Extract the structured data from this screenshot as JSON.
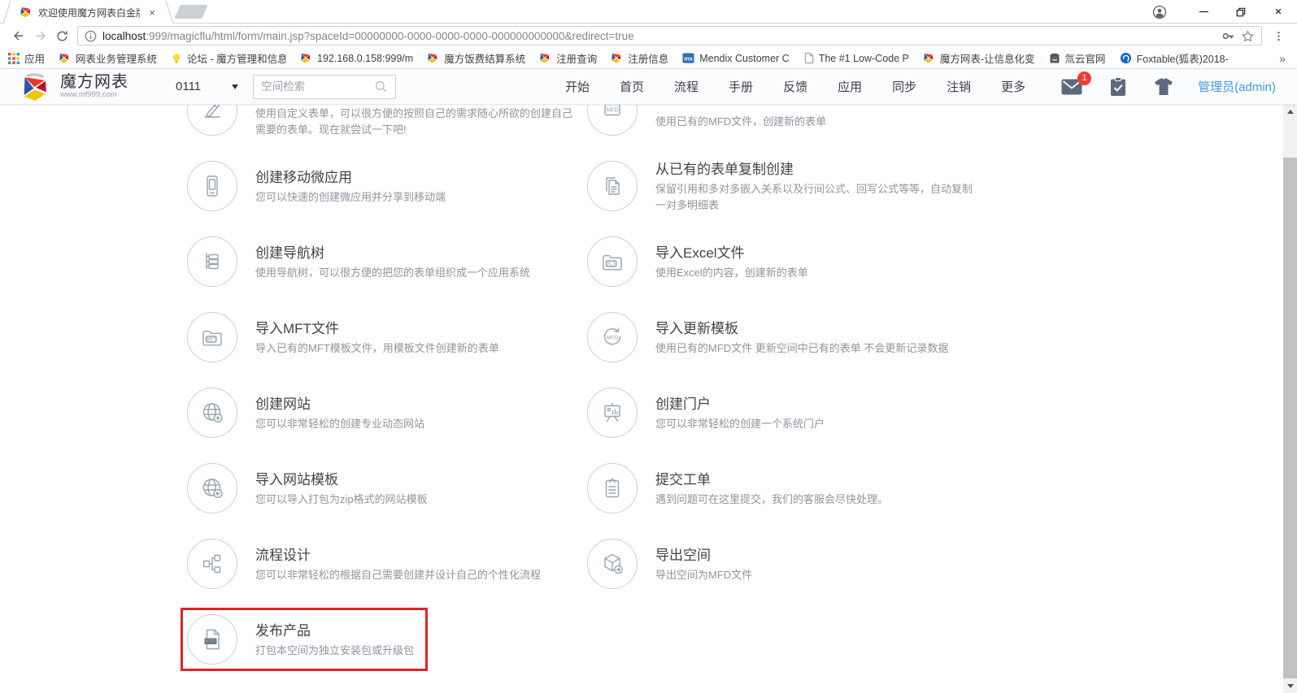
{
  "browser": {
    "tab_title": "欢迎使用魔方网表白金版",
    "tab_close": "×",
    "url_host": "localhost",
    "url_rest": ":999/magicflu/html/form/main.jsp?spaceId=00000000-0000-0000-0000-000000000000&redirect=true",
    "bookmarks": [
      {
        "icon": "apps-grid-icon",
        "label": "应用"
      },
      {
        "icon": "magicflu-favicon",
        "label": "网表业务管理系统"
      },
      {
        "icon": "lamp-icon",
        "label": "论坛 - 魔方管理和信息"
      },
      {
        "icon": "magicflu-favicon",
        "label": "192.168.0.158:999/m"
      },
      {
        "icon": "magicflu-favicon",
        "label": "魔方饭费结算系统"
      },
      {
        "icon": "magicflu-favicon",
        "label": "注册查询"
      },
      {
        "icon": "magicflu-favicon",
        "label": "注册信息"
      },
      {
        "icon": "mendix-icon",
        "label": "Mendix Customer C"
      },
      {
        "icon": "page-icon",
        "label": "The #1 Low-Code P"
      },
      {
        "icon": "magicflu-favicon",
        "label": "魔方网表-让信息化变"
      },
      {
        "icon": "hcloud-icon",
        "label": "氚云官网"
      },
      {
        "icon": "foxtable-icon",
        "label": "Foxtable(狐表)2018-"
      }
    ],
    "bookmarks_overflow": "»"
  },
  "header": {
    "logo_title": "魔方网表",
    "logo_sub": "www.mf999.com",
    "space_id": "0111",
    "search_placeholder": "空间检索",
    "nav": [
      "开始",
      "首页",
      "流程",
      "手册",
      "反馈",
      "应用",
      "同步",
      "注销",
      "更多"
    ],
    "badge_count": "1",
    "user": "管理员(admin)",
    "accent_blue": "#3d9be0",
    "badge_red": "#f23c30"
  },
  "features": {
    "highlight_color": "#e82020",
    "rows": [
      {
        "left": {
          "title": "",
          "desc": "使用自定义表单，可以很方便的按照自己的需求随心所欲的创建自己需要的表单。现在就尝试一下吧!",
          "icon": "form-pen-icon"
        },
        "right": {
          "title": "",
          "desc": "使用已有的MFD文件，创建新的表单",
          "icon": "mfd-file-icon"
        }
      },
      {
        "left": {
          "title": "创建移动微应用",
          "desc": "您可以快速的创建微应用并分享到移动端",
          "icon": "smartphone-icon"
        },
        "right": {
          "title": "从已有的表单复制创建",
          "desc": "保留引用和多对多嵌入关系以及行间公式、回写公式等等，自动复制一对多明细表",
          "icon": "copy-docs-icon"
        }
      },
      {
        "left": {
          "title": "创建导航树",
          "desc": "使用导航树，可以很方便的把您的表单组织成一个应用系统",
          "icon": "nav-tree-icon"
        },
        "right": {
          "title": "导入Excel文件",
          "desc": "使用Excel的内容，创建新的表单",
          "icon": "xls-folder-icon"
        }
      },
      {
        "left": {
          "title": "导入MFT文件",
          "desc": "导入已有的MFT模板文件，用模板文件创建新的表单",
          "icon": "mft-folder-icon"
        },
        "right": {
          "title": "导入更新模板",
          "desc": "使用已有的MFD文件 更新空间中已有的表单 不会更新记录数据",
          "icon": "mfd-refresh-icon"
        }
      },
      {
        "left": {
          "title": "创建网站",
          "desc": "您可以非常轻松的创建专业动态网站",
          "icon": "globe-plus-icon"
        },
        "right": {
          "title": "创建门户",
          "desc": "您可以非常轻松的创建一个系统门户",
          "icon": "portal-board-icon"
        }
      },
      {
        "left": {
          "title": "导入网站模板",
          "desc": "您可以导入打包为zip格式的网站模板",
          "icon": "globe-import-icon"
        },
        "right": {
          "title": "提交工单",
          "desc": "遇到问题可在这里提交，我们的客服会尽快处理。",
          "icon": "ticket-clipboard-icon"
        }
      },
      {
        "left": {
          "title": "流程设计",
          "desc": "您可以非常轻松的根据自己需要创建并设计自己的个性化流程",
          "icon": "flowchart-icon"
        },
        "right": {
          "title": "导出空间",
          "desc": "导出空间为MFD文件",
          "icon": "cube-export-icon"
        }
      },
      {
        "left": {
          "title": "发布产品",
          "desc": "打包本空间为独立安装包或升级包",
          "icon": "exe-file-icon",
          "highlighted": true
        }
      }
    ]
  }
}
